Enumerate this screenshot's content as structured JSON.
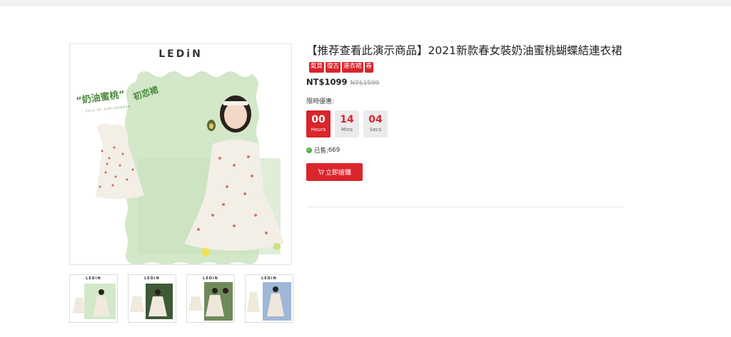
{
  "page": {
    "brand": "LEDiN",
    "main_image": {
      "alt": "",
      "tagline": "“奶油蜜桃”",
      "tagline_alt": "初恋裙",
      "subtag": "FULL OF GIRLISHNESS"
    },
    "thumbnails": [
      {
        "brand": "LEDiN"
      },
      {
        "brand": "LEDiN"
      },
      {
        "brand": "LEDiN"
      },
      {
        "brand": "LEDiN"
      }
    ]
  },
  "product": {
    "title": "【推荐查看此演示商品】2021新款春女裝奶油蜜桃蝴蝶結連衣裙",
    "tags": [
      "氣質",
      "復古",
      "連衣裙",
      "春"
    ],
    "price": "NT$1099",
    "old_price": "NT$1599",
    "promo_label": "限時優惠:",
    "countdown": {
      "hours": {
        "value": "00",
        "unit": "Hours"
      },
      "mins": {
        "value": "14",
        "unit": "Mins"
      },
      "secs": {
        "value": "04",
        "unit": "Secs"
      }
    },
    "sold_label": "已售:",
    "sold_count": "669",
    "buy_label": "立即搶購"
  },
  "colors": {
    "accent": "#d9252b",
    "mint": "#cfe6c6",
    "success": "#4bb543"
  },
  "icons": [
    "check-icon",
    "cart-icon"
  ]
}
